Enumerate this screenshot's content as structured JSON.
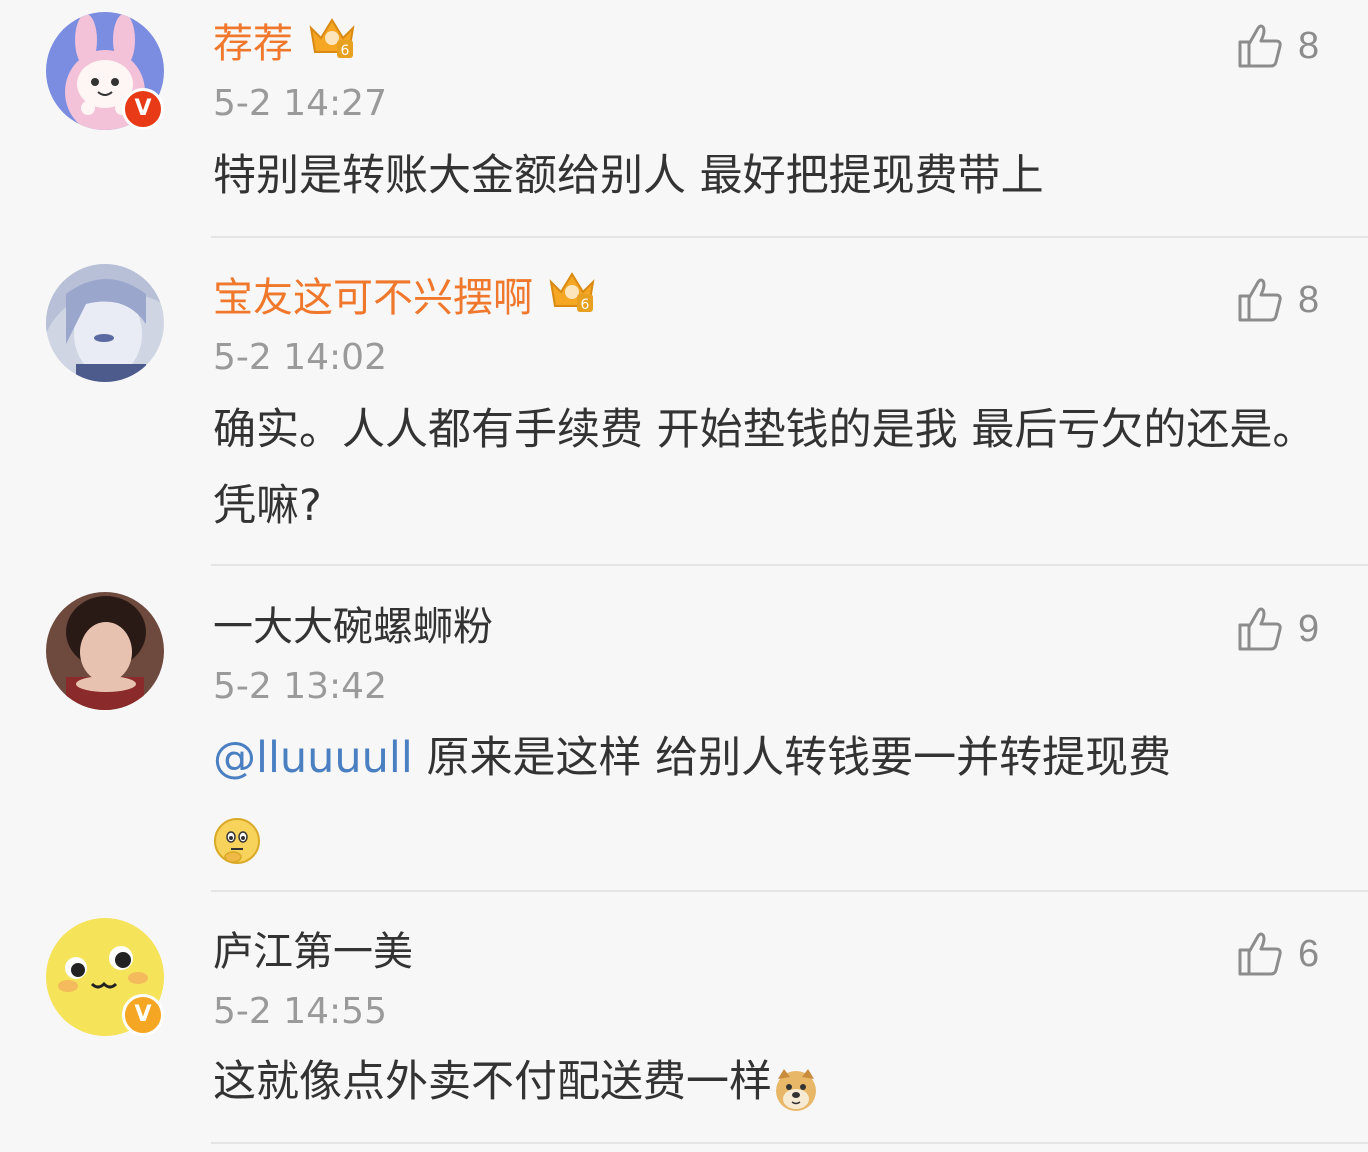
{
  "comments": [
    {
      "username": "荐荐",
      "member_level": "6",
      "time": "5-2 14:27",
      "text": "特别是转账大金额给别人 最好把提现费带上",
      "likes": "8",
      "verified": "V"
    },
    {
      "username": "宝友这可不兴摆啊",
      "member_level": "6",
      "time": "5-2 14:02",
      "text": "确实。人人都有手续费 开始垫钱的是我 最后亏欠的还是。凭嘛?",
      "likes": "8"
    },
    {
      "username": "一大大碗螺蛳粉",
      "time": "5-2 13:42",
      "mention": "@lluuuull",
      "text": " 原来是这样 给别人转钱要一并转提现费",
      "emoji": "thinking-emoji",
      "likes": "9"
    },
    {
      "username": "庐江第一美",
      "time": "5-2 14:55",
      "text": "这就像点外卖不付配送费一样",
      "emoji": "doge-emoji",
      "likes": "6",
      "verified": "V"
    }
  ],
  "colors": {
    "member_name": "#f0782d",
    "normal_name": "#333333",
    "time": "#9a9a9a",
    "mention": "#4a7fc1",
    "background": "#f7f7f7"
  }
}
